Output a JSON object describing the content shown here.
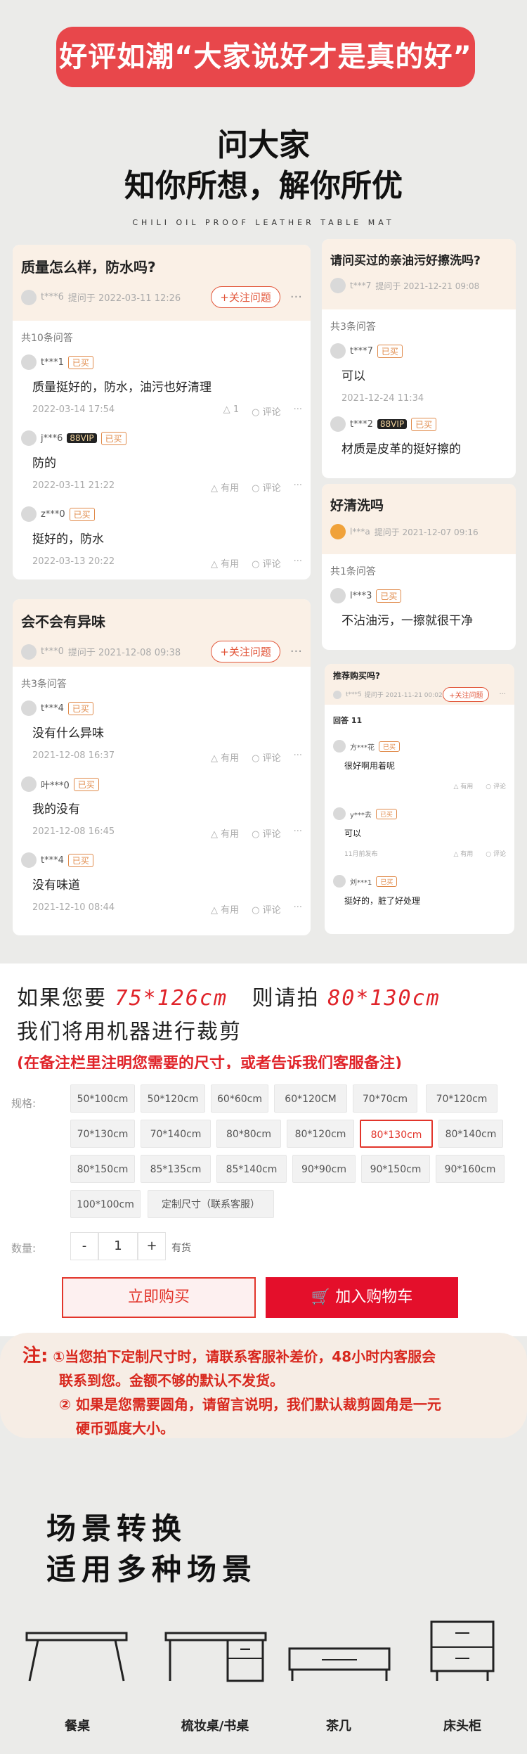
{
  "banner": "好评如潮“大家说好才是真的好”",
  "heading": {
    "line1": "问大家",
    "line2": "知你所想，解你所优",
    "sub": "CHILI OIL PROOF LEATHER TABLE MAT"
  },
  "qa": {
    "q1": {
      "title": "质量怎么样，防水吗?",
      "user": "t***6",
      "date": "提问于 2022-03-11 12:26",
      "follow": "+关注问题",
      "count": "共10条问答",
      "answers": [
        {
          "user": "t***1",
          "tag": "已买",
          "text": "质量挺好的，防水，油污也好清理",
          "date": "2022-03-14 17:54",
          "like": "1",
          "comment": "评论"
        },
        {
          "user": "j***6",
          "vip": "88VIP",
          "tag": "已买",
          "text": "防的",
          "date": "2022-03-11 21:22",
          "like": "有用",
          "comment": "评论"
        },
        {
          "user": "z***0",
          "tag": "已买",
          "text": "挺好的，防水",
          "date": "2022-03-13 20:22",
          "like": "有用",
          "comment": "评论"
        }
      ]
    },
    "q2": {
      "title": "会不会有异味",
      "user": "t***0",
      "date": "提问于 2021-12-08 09:38",
      "follow": "+关注问题",
      "count": "共3条问答",
      "answers": [
        {
          "user": "t***4",
          "tag": "已买",
          "text": "没有什么异味",
          "date": "2021-12-08 16:37",
          "like": "有用",
          "comment": "评论"
        },
        {
          "user": "叶***0",
          "tag": "已买",
          "text": "我的没有",
          "date": "2021-12-08 16:45",
          "like": "有用",
          "comment": "评论"
        },
        {
          "user": "t***4",
          "tag": "已买",
          "text": "没有味道",
          "date": "2021-12-10 08:44",
          "like": "有用",
          "comment": "评论"
        }
      ]
    },
    "q3": {
      "title": "请问买过的亲油污好擦洗吗?",
      "user": "t***7",
      "date": "提问于 2021-12-21 09:08",
      "count": "共3条问答",
      "answers": [
        {
          "user": "t***7",
          "tag": "已买",
          "text": "可以",
          "date": "2021-12-24 11:34"
        },
        {
          "user": "t***2",
          "vip": "88VIP",
          "tag": "已买",
          "text": "材质是皮革的挺好擦的"
        }
      ]
    },
    "q4": {
      "title": "好清洗吗",
      "user": "l***a",
      "date": "提问于 2021-12-07 09:16",
      "count": "共1条问答",
      "answers": [
        {
          "user": "l***3",
          "tag": "已买",
          "text": "不沾油污，一擦就很干净"
        }
      ]
    },
    "q5": {
      "title": "推荐购买吗?",
      "user": "t***5",
      "date": "提问于 2021-11-21 00:02",
      "follow": "+关注问题",
      "count": "回答 11",
      "answers": [
        {
          "user": "方***花",
          "tag": "已买",
          "text": "很好啊用着呢",
          "like": "有用",
          "comment": "评论"
        },
        {
          "user": "y***去",
          "tag": "已买",
          "text": "可以",
          "date": "11月前发布",
          "like": "有用",
          "comment": "评论"
        },
        {
          "user": "刘***1",
          "tag": "已买",
          "text": "挺好的，脏了好处理"
        }
      ]
    }
  },
  "size_note": {
    "prefix": "如果您要",
    "size_a": "75*126cm",
    "mid": "则请拍",
    "size_b": "80*130cm",
    "line2": "我们将用机器进行裁剪",
    "line3": "(在备注栏里注明您需要的尺寸，或者告诉我们客服备注)"
  },
  "spec": {
    "label": "规格:",
    "options": [
      "50*100cm",
      "50*120cm",
      "60*60cm",
      "60*120CM",
      "70*70cm",
      "70*120cm",
      "70*130cm",
      "70*140cm",
      "80*80cm",
      "80*120cm",
      "80*130cm",
      "80*140cm",
      "80*150cm",
      "85*135cm",
      "85*140cm",
      "90*90cm",
      "90*150cm",
      "90*160cm",
      "100*100cm",
      "定制尺寸（联系客服）"
    ],
    "selected": "80*130cm",
    "qty_label": "数量:",
    "qty_minus": "-",
    "qty_value": "1",
    "qty_plus": "+",
    "stock": "有货",
    "buy": "立即购买",
    "cart": "加入购物车"
  },
  "note": {
    "label": "注:",
    "l1": "①当您拍下定制尺寸时，请联系客服补差价，48小时内客服会",
    "l2": "联系到您。金额不够的默认不发货。",
    "l3": "② 如果是您需要圆角，请留言说明，我们默认裁剪圆角是一元",
    "l4": "硬币弧度大小。"
  },
  "scene": {
    "title1": "场景转换",
    "title2": "适用多种场景",
    "labels": [
      "餐桌",
      "梳妆桌/书桌",
      "茶几",
      "床头柜"
    ]
  },
  "colors": {
    "accent": "#e8474b",
    "red": "#e2352b",
    "tag": "#e08a4a"
  }
}
